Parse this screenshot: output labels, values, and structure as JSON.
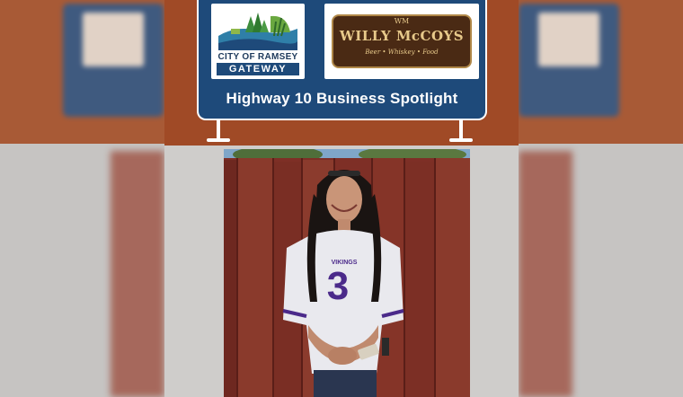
{
  "banner": {
    "title": "Highway 10 Business Spotlight",
    "logo_ramsey": {
      "line1": "CITY OF RAMSEY",
      "line2": "GATEWAY"
    },
    "logo_willy": {
      "monogram": "WM",
      "name": "WILLY McCOYS",
      "tagline": "Beer • Whiskey • Food"
    }
  },
  "photo": {
    "jersey_label": "VIKINGS",
    "jersey_number": "3"
  },
  "colors": {
    "sign_blue": "#1e4a7a",
    "banner_rust": "#a04a26",
    "fence_red": "#7a2e26",
    "jersey_white": "#e9e9ee",
    "jersey_purple": "#4b2a8a"
  }
}
